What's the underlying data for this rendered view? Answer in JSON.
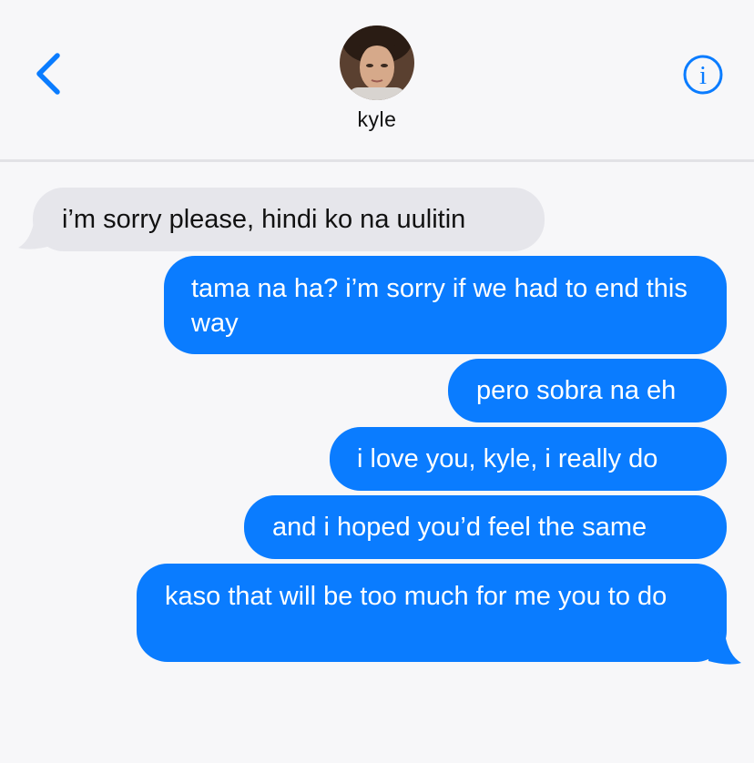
{
  "header": {
    "contact_name": "kyle",
    "back_icon": "chevron-left-icon",
    "info_icon": "info-icon",
    "info_glyph": "i",
    "accent_color": "#0a7cff"
  },
  "messages": [
    {
      "direction": "incoming",
      "text": "i’m sorry please, hindi ko na uulitin"
    },
    {
      "direction": "outgoing",
      "text": "tama na ha? i’m sorry if we had to end this way"
    },
    {
      "direction": "outgoing",
      "text": "pero sobra na eh"
    },
    {
      "direction": "outgoing",
      "text": "i love you, kyle, i really do"
    },
    {
      "direction": "outgoing",
      "text": "and i hoped you’d feel the same"
    },
    {
      "direction": "outgoing",
      "text": "kaso that will be too much for me you to do"
    }
  ]
}
